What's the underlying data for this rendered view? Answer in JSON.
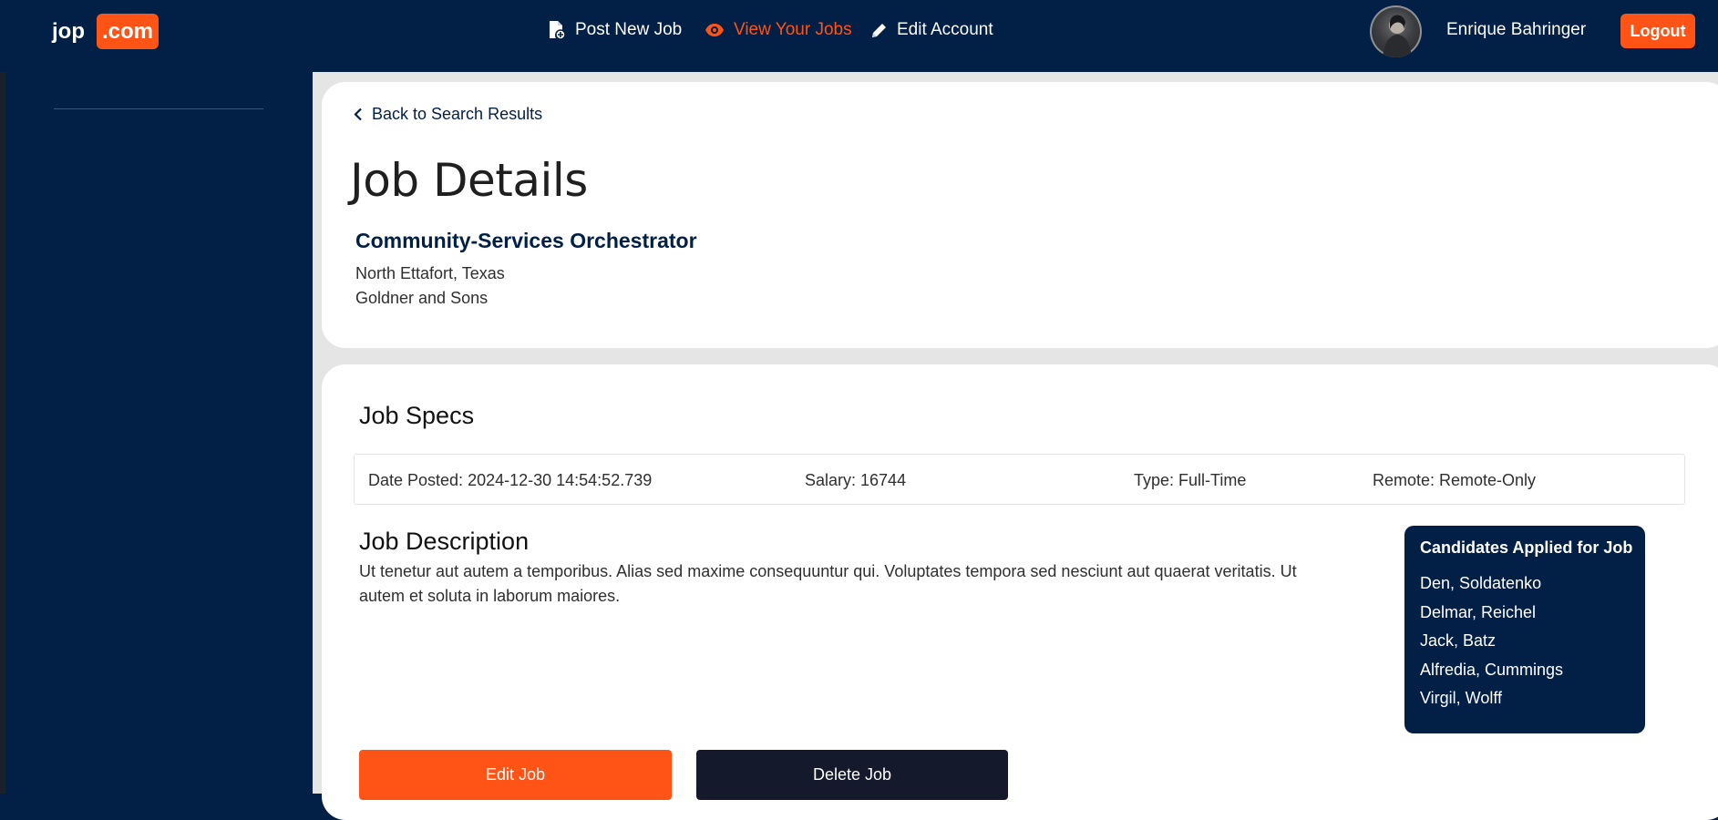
{
  "header": {
    "brand_jop": "jop",
    "brand_com": ".com",
    "nav": {
      "post_new_job": "Post New Job",
      "view_your_jobs": "View Your Jobs",
      "edit_account": "Edit Account"
    },
    "user_name": "Enrique Bahringer",
    "logout_label": "Logout"
  },
  "job": {
    "back_link": "Back to Search Results",
    "page_title": "Job Details",
    "title": "Community-Services Orchestrator",
    "location": "North Ettafort, Texas",
    "company": "Goldner and Sons"
  },
  "specs": {
    "heading": "Job Specs",
    "date_posted": "Date Posted: 2024-12-30 14:54:52.739",
    "salary": "Salary: 16744",
    "type": "Type: Full-Time",
    "remote": "Remote: Remote-Only"
  },
  "description": {
    "heading": "Job Description",
    "text": "Ut tenetur aut autem a temporibus. Alias sed maxime consequuntur qui. Voluptates tempora sed nesciunt aut quaerat veritatis. Ut autem et soluta in laborum maiores."
  },
  "candidates": {
    "heading": "Candidates Applied for Job",
    "list": [
      "Den, Soldatenko",
      "Delmar, Reichel",
      "Jack, Batz",
      "Alfredia, Cummings",
      "Virgil, Wolff"
    ]
  },
  "actions": {
    "edit_label": "Edit Job",
    "delete_label": "Delete Job"
  },
  "colors": {
    "navy": "#021f45",
    "accent": "#ff5416",
    "dark_button": "#141a2c"
  },
  "icons": {
    "post_new_job": "file-plus-icon",
    "view_your_jobs": "eye-icon",
    "edit_account": "pencil-icon",
    "back": "chevron-left-icon"
  }
}
